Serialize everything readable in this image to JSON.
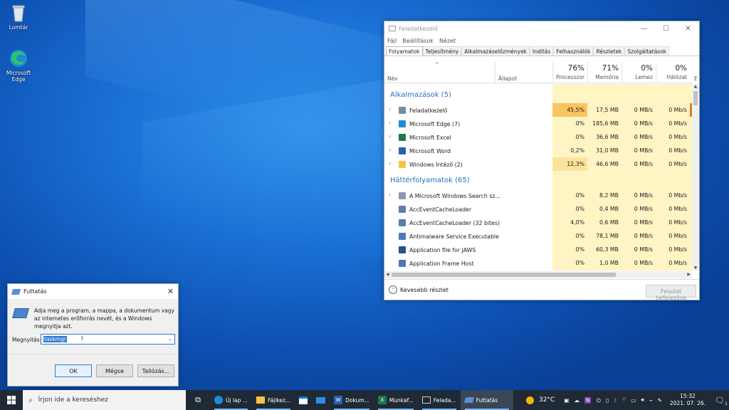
{
  "desktop": {
    "recycle_bin": "Lomtár",
    "edge": "Microsoft Edge"
  },
  "taskmgr": {
    "title": "Feladatkezelő",
    "menu": [
      "Fájl",
      "Beállítások",
      "Nézet"
    ],
    "tabs": [
      "Folyamatok",
      "Teljesítmény",
      "Alkalmazáselőzmények",
      "Indítás",
      "Felhasználók",
      "Részletek",
      "Szolgáltatások"
    ],
    "columns": {
      "name": "Név",
      "status": "Állapot",
      "cpu_pct": "76%",
      "cpu": "Processzor",
      "mem_pct": "71%",
      "mem": "Memória",
      "disk_pct": "0%",
      "disk": "Lemez",
      "net_pct": "0%",
      "net": "Hálózat",
      "extra": "E"
    },
    "group_apps": "Alkalmazások (5)",
    "group_bg": "Háttérfolyamatok (65)",
    "apps": [
      {
        "name": "Feladatkezelő",
        "cpu": "45,5%",
        "mem": "17,5 MB",
        "disk": "0 MB/s",
        "net": "0 Mb/s"
      },
      {
        "name": "Microsoft Edge (7)",
        "cpu": "0%",
        "mem": "185,6 MB",
        "disk": "0 MB/s",
        "net": "0 Mb/s"
      },
      {
        "name": "Microsoft Excel",
        "cpu": "0%",
        "mem": "36,6 MB",
        "disk": "0 MB/s",
        "net": "0 Mb/s"
      },
      {
        "name": "Microsoft Word",
        "cpu": "0,2%",
        "mem": "31,0 MB",
        "disk": "0 MB/s",
        "net": "0 Mb/s"
      },
      {
        "name": "Windows Intéző (2)",
        "cpu": "12,3%",
        "mem": "46,6 MB",
        "disk": "0 MB/s",
        "net": "0 Mb/s"
      }
    ],
    "bg": [
      {
        "name": "A Microsoft Windows Search sz...",
        "cpu": "0%",
        "mem": "8,2 MB",
        "disk": "0 MB/s",
        "net": "0 Mb/s"
      },
      {
        "name": "AccEventCacheLoader",
        "cpu": "0%",
        "mem": "0,4 MB",
        "disk": "0 MB/s",
        "net": "0 Mb/s"
      },
      {
        "name": "AccEventCacheLoader (32 bites)",
        "cpu": "4,0%",
        "mem": "0,6 MB",
        "disk": "0 MB/s",
        "net": "0 Mb/s"
      },
      {
        "name": "Antimalware Service Executable",
        "cpu": "0%",
        "mem": "78,1 MB",
        "disk": "0 MB/s",
        "net": "0 Mb/s"
      },
      {
        "name": "Application file for JAWS",
        "cpu": "0%",
        "mem": "60,3 MB",
        "disk": "0 MB/s",
        "net": "0 Mb/s"
      },
      {
        "name": "Application Frame Host",
        "cpu": "0%",
        "mem": "1,0 MB",
        "disk": "0 MB/s",
        "net": "0 Mb/s"
      }
    ],
    "fewer_details": "Kevesebb részlet",
    "end_task": "Feladat befejezése"
  },
  "run": {
    "title": "Futtatás",
    "description": "Adja meg a program, a mappa, a dokumentum vagy az internetes erőforrás nevét, és a Windows megnyitja azt.",
    "open_label": "Megnyitás:",
    "open_value": "taskmgr",
    "ok": "OK",
    "cancel": "Mégse",
    "browse": "Tallózás..."
  },
  "taskbar": {
    "search_placeholder": "Írjon ide a kereséshez",
    "apps": [
      "Új lap ...",
      "Fájlkez...",
      "Dokum...",
      "Munkaf...",
      "Felada...",
      "Futtatás"
    ],
    "temperature": "32°C",
    "time": "15:32",
    "date": "2021. 07. 26.",
    "notif_count": "1"
  }
}
